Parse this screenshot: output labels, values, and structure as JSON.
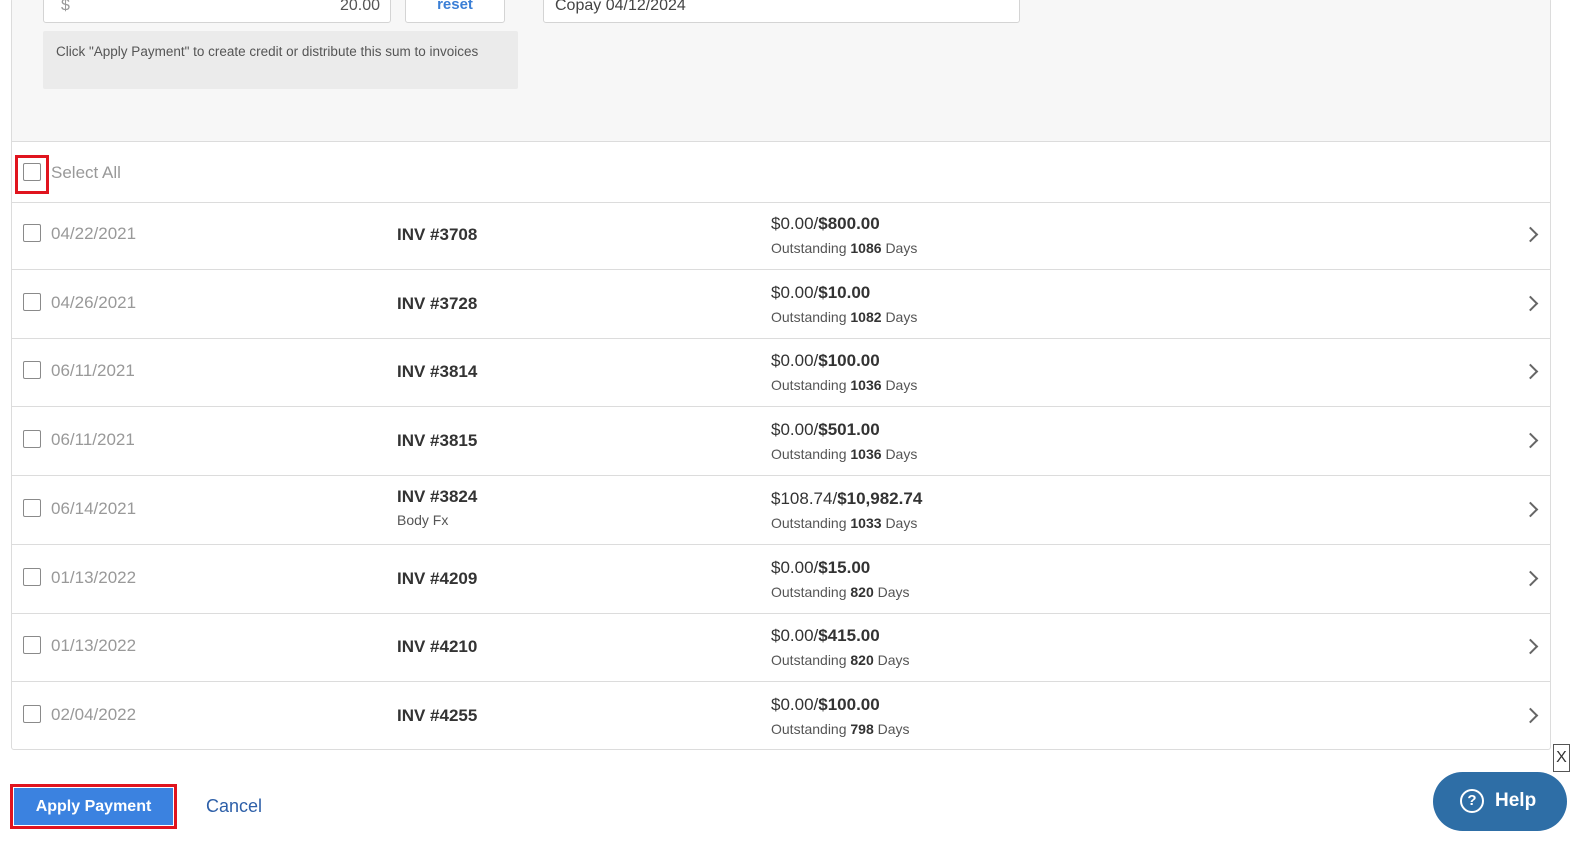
{
  "payment": {
    "currency_symbol": "$",
    "amount": "20.00",
    "reset_label": "reset",
    "memo": "Copay 04/12/2024",
    "hint": "Click \"Apply Payment\" to create credit or distribute this sum to invoices"
  },
  "select_all_label": "Select All",
  "outstanding_label": "Outstanding",
  "days_label": "Days",
  "invoices": [
    {
      "date": "04/22/2021",
      "number": "INV #3708",
      "sub": "",
      "paid": "$0.00/",
      "total": "$800.00",
      "days": "1086"
    },
    {
      "date": "04/26/2021",
      "number": "INV #3728",
      "sub": "",
      "paid": "$0.00/",
      "total": "$10.00",
      "days": "1082"
    },
    {
      "date": "06/11/2021",
      "number": "INV #3814",
      "sub": "",
      "paid": "$0.00/",
      "total": "$100.00",
      "days": "1036"
    },
    {
      "date": "06/11/2021",
      "number": "INV #3815",
      "sub": "",
      "paid": "$0.00/",
      "total": "$501.00",
      "days": "1036"
    },
    {
      "date": "06/14/2021",
      "number": "INV #3824",
      "sub": "Body Fx",
      "paid": "$108.74/",
      "total": "$10,982.74",
      "days": "1033"
    },
    {
      "date": "01/13/2022",
      "number": "INV #4209",
      "sub": "",
      "paid": "$0.00/",
      "total": "$15.00",
      "days": "820"
    },
    {
      "date": "01/13/2022",
      "number": "INV #4210",
      "sub": "",
      "paid": "$0.00/",
      "total": "$415.00",
      "days": "820"
    },
    {
      "date": "02/04/2022",
      "number": "INV #4255",
      "sub": "",
      "paid": "$0.00/",
      "total": "$100.00",
      "days": "798"
    }
  ],
  "footer": {
    "apply_label": "Apply Payment",
    "cancel_label": "Cancel",
    "help_label": "Help",
    "help_icon_glyph": "?",
    "close_glyph": "X"
  },
  "colors": {
    "highlight": "#e0141e",
    "primary": "#3b82e0",
    "help": "#2e6ea6"
  }
}
